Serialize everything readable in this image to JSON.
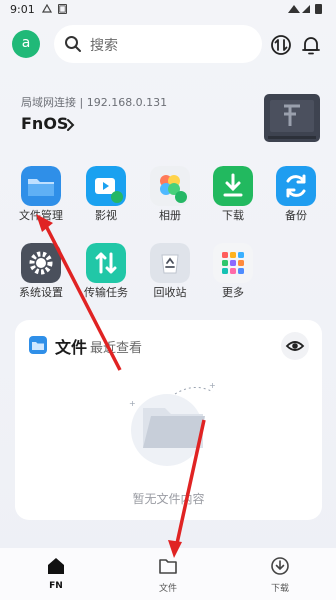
{
  "status_bar": {
    "time": "9:01"
  },
  "header": {
    "avatar_letter": "a",
    "search_placeholder": "搜索"
  },
  "server": {
    "connection": "局域网连接 | 192.168.0.131",
    "name": "FnOS"
  },
  "apps": [
    {
      "label": "文件管理",
      "icon": "folder-icon"
    },
    {
      "label": "影视",
      "icon": "video-icon"
    },
    {
      "label": "相册",
      "icon": "photos-icon"
    },
    {
      "label": "下载",
      "icon": "download-icon"
    },
    {
      "label": "备份",
      "icon": "backup-icon"
    },
    {
      "label": "系统设置",
      "icon": "gear-icon"
    },
    {
      "label": "传输任务",
      "icon": "transfer-icon"
    },
    {
      "label": "回收站",
      "icon": "recycle-icon"
    },
    {
      "label": "更多",
      "icon": "more-icon"
    }
  ],
  "files_card": {
    "title": "文件",
    "subtitle": "最近查看",
    "empty_text": "暂无文件内容"
  },
  "bottom_nav": [
    {
      "label": "FN",
      "icon": "home-icon",
      "active": true
    },
    {
      "label": "文件",
      "icon": "folder-outline-icon",
      "active": false
    },
    {
      "label": "下载",
      "icon": "download-outline-icon",
      "active": false
    }
  ],
  "colors": {
    "accent_green": "#20b978",
    "annotation_red": "#e02323"
  }
}
